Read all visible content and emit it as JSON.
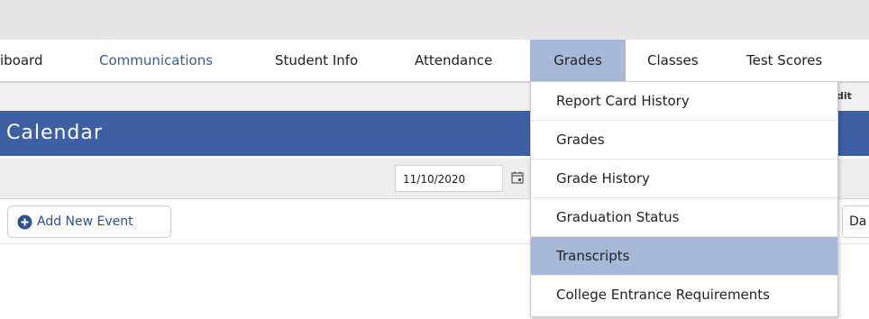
{
  "nav": {
    "items": [
      {
        "label": "iboard",
        "style": "plain"
      },
      {
        "label": "Communications",
        "style": "link"
      },
      {
        "label": "Student Info",
        "style": "plain"
      },
      {
        "label": "Attendance",
        "style": "plain"
      },
      {
        "label": "Grades",
        "style": "active"
      },
      {
        "label": "Classes",
        "style": "plain"
      },
      {
        "label": "Test Scores",
        "style": "plain"
      }
    ]
  },
  "subband": {
    "edit_fragment": "dit"
  },
  "calendar": {
    "title": "Calendar",
    "date_value": "11/10/2020",
    "add_event_label": "Add New Event",
    "right_button_label": "Da"
  },
  "dropdown": {
    "items": [
      {
        "label": "Report Card History",
        "highlighted": false
      },
      {
        "label": "Grades",
        "highlighted": false
      },
      {
        "label": "Grade History",
        "highlighted": false
      },
      {
        "label": "Graduation Status",
        "highlighted": false
      },
      {
        "label": "Transcripts",
        "highlighted": true
      },
      {
        "label": "College Entrance Requirements",
        "highlighted": false
      }
    ]
  },
  "colors": {
    "title_bar": "#3d5fa3",
    "active_tab": "#a8b8d8",
    "link": "#3b5998"
  },
  "icons": {
    "calendar": "calendar-icon",
    "add": "plus-circle-icon"
  }
}
